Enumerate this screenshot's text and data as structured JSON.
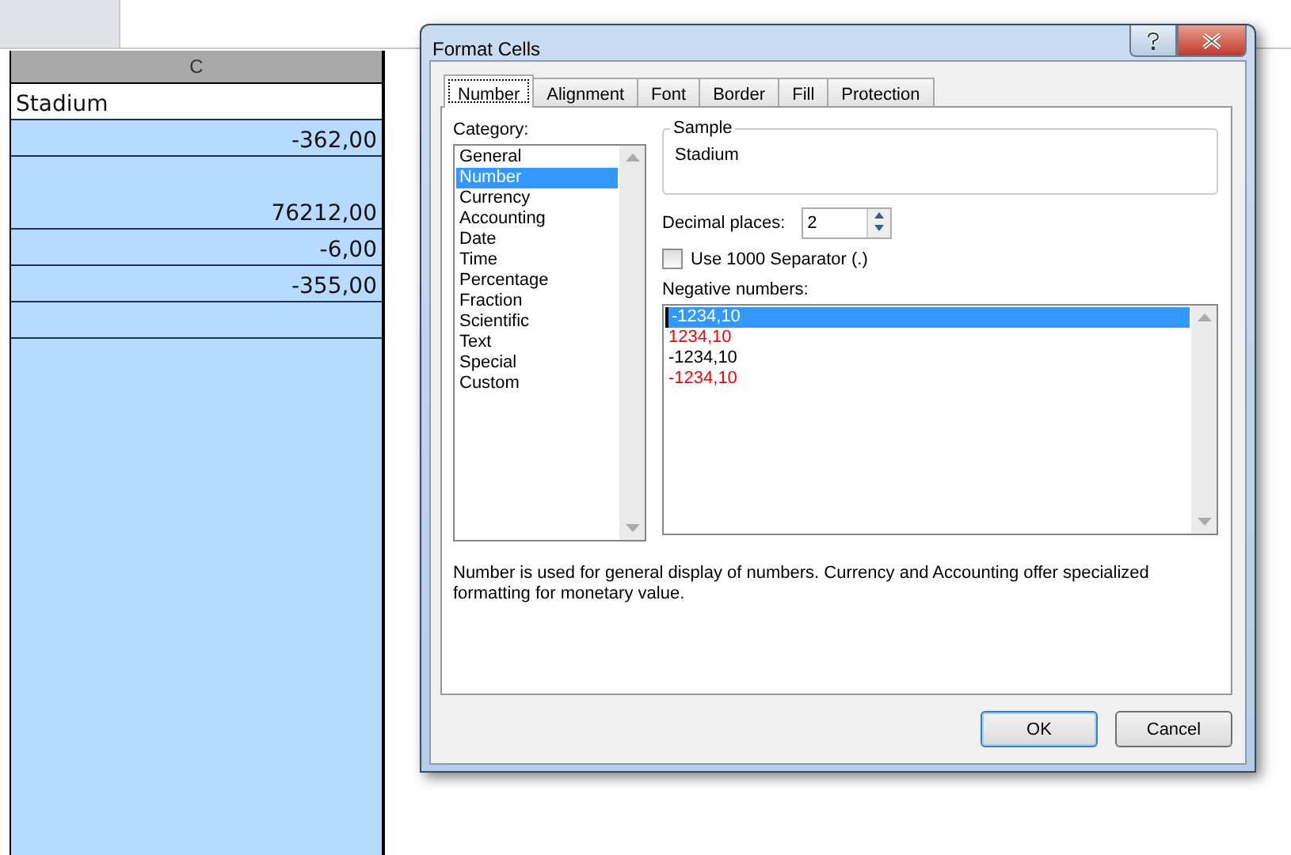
{
  "spreadsheet": {
    "column_header": "C",
    "cells": [
      {
        "value": "Stadium",
        "kind": "text",
        "active": true
      },
      {
        "value": "-362,00",
        "kind": "number",
        "active": false
      },
      {
        "value": "76212,00",
        "kind": "number",
        "active": false
      },
      {
        "value": "-6,00",
        "kind": "number",
        "active": false
      },
      {
        "value": "-355,00",
        "kind": "number",
        "active": false
      }
    ]
  },
  "dialog": {
    "title": "Format Cells",
    "tabs": [
      {
        "label": "Number",
        "selected": true
      },
      {
        "label": "Alignment",
        "selected": false
      },
      {
        "label": "Font",
        "selected": false
      },
      {
        "label": "Border",
        "selected": false
      },
      {
        "label": "Fill",
        "selected": false
      },
      {
        "label": "Protection",
        "selected": false
      }
    ],
    "category": {
      "label": "Category:",
      "items": [
        {
          "label": "General",
          "selected": false
        },
        {
          "label": "Number",
          "selected": true
        },
        {
          "label": "Currency",
          "selected": false
        },
        {
          "label": "Accounting",
          "selected": false
        },
        {
          "label": "Date",
          "selected": false
        },
        {
          "label": "Time",
          "selected": false
        },
        {
          "label": "Percentage",
          "selected": false
        },
        {
          "label": "Fraction",
          "selected": false
        },
        {
          "label": "Scientific",
          "selected": false
        },
        {
          "label": "Text",
          "selected": false
        },
        {
          "label": "Special",
          "selected": false
        },
        {
          "label": "Custom",
          "selected": false
        }
      ]
    },
    "sample": {
      "label": "Sample",
      "value": "Stadium"
    },
    "decimal_places": {
      "label": "Decimal places:",
      "value": "2"
    },
    "separator": {
      "label": "Use 1000 Separator (.)",
      "checked": false
    },
    "negative_numbers": {
      "label": "Negative numbers:",
      "items": [
        {
          "label": "-1234,10",
          "color": "#000000",
          "selected": true
        },
        {
          "label": "1234,10",
          "color": "#ff0000",
          "selected": false
        },
        {
          "label": "-1234,10",
          "color": "#000000",
          "selected": false
        },
        {
          "label": "-1234,10",
          "color": "#ff0000",
          "selected": false
        }
      ]
    },
    "description": "Number is used for general display of numbers.  Currency and Accounting offer specialized formatting for monetary value.",
    "buttons": [
      {
        "label": "OK",
        "default": true
      },
      {
        "label": "Cancel",
        "default": false
      }
    ]
  }
}
